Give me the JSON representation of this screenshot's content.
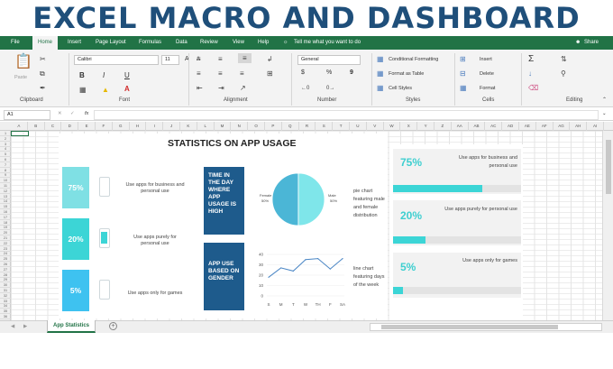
{
  "banner": {
    "title": "EXCEL MACRO AND DASHBOARD"
  },
  "menu": {
    "tabs": [
      "File",
      "Home",
      "Insert",
      "Page Layout",
      "Formulas",
      "Data",
      "Review",
      "View",
      "Help"
    ],
    "tell_me": "Tell me what you want to do",
    "share": "Share"
  },
  "ribbon": {
    "clipboard": {
      "paste": "Paste",
      "label": "Clipboard"
    },
    "font": {
      "name": "Calibri",
      "size": "11",
      "bold": "B",
      "italic": "I",
      "underline": "U",
      "grow": "A",
      "shrink": "A",
      "label": "Font"
    },
    "alignment": {
      "label": "Alignment"
    },
    "number": {
      "format": "General",
      "currency": "$",
      "percent": "%",
      "comma": "9",
      "label": "Number"
    },
    "styles": {
      "conditional": "Conditional Formatting",
      "table": "Format as Table",
      "cell": "Cell Styles",
      "label": "Styles"
    },
    "cells": {
      "insert": "Insert",
      "delete": "Delete",
      "format": "Format",
      "label": "Cells"
    },
    "editing": {
      "sum": "Σ",
      "label": "Editing"
    }
  },
  "formula_bar": {
    "cell_ref": "A1",
    "fx": "fx",
    "value": ""
  },
  "columns": [
    "A",
    "B",
    "C",
    "D",
    "E",
    "F",
    "G",
    "H",
    "I",
    "J",
    "K",
    "L",
    "M",
    "N",
    "O",
    "P",
    "Q",
    "R",
    "S",
    "T",
    "U",
    "V",
    "W",
    "X",
    "Y",
    "Z",
    "AA",
    "AB",
    "AC",
    "AD",
    "AE",
    "AF",
    "AG",
    "AH",
    "AI"
  ],
  "rows": [
    "1",
    "2",
    "3",
    "4",
    "5",
    "6",
    "7",
    "8",
    "9",
    "10",
    "11",
    "12",
    "13",
    "14",
    "15",
    "16",
    "17",
    "18",
    "19",
    "20",
    "21",
    "22",
    "23",
    "24",
    "25",
    "26",
    "27",
    "28",
    "29",
    "30",
    "31",
    "32",
    "33",
    "34",
    "35",
    "36"
  ],
  "dashboard": {
    "title": "STATISTICS ON APP USAGE",
    "stats": [
      {
        "pct": "75%",
        "text": "Use apps for business and personal use"
      },
      {
        "pct": "20%",
        "text": "Use apps purely for personal use"
      },
      {
        "pct": "5%",
        "text": "Use apps only for games"
      }
    ],
    "boxes": [
      {
        "text": "TIME IN THE DAY WHERE APP USAGE IS HIGH"
      },
      {
        "text": "APP USE BASED ON GENDER"
      }
    ],
    "pie_note": "pie chart featuring male and female distribution",
    "line_note": "line chart featuring days of the week",
    "right_cards": [
      {
        "pct": "75%",
        "text": "Use apps for business and personal use",
        "fill": 0.7
      },
      {
        "pct": "20%",
        "text": "Use apps purely for personal use",
        "fill": 0.25
      },
      {
        "pct": "5%",
        "text": "Use apps only for games",
        "fill": 0.08
      }
    ],
    "colors": {
      "teal": "#3cd5d6",
      "navy": "#1e5b8c",
      "excel_green": "#217346"
    }
  },
  "chart_data": [
    {
      "type": "pie",
      "labels": [
        "Female",
        "Male"
      ],
      "values": [
        50,
        50
      ],
      "data_labels": [
        "50%",
        "50%"
      ]
    },
    {
      "type": "line",
      "categories": [
        "S",
        "M",
        "T",
        "W",
        "TH",
        "F",
        "SA"
      ],
      "values": [
        18,
        27,
        24,
        35,
        36,
        26,
        36
      ],
      "ylim": [
        0,
        40
      ],
      "yticks": [
        "0",
        "10",
        "20",
        "30",
        "40"
      ]
    }
  ],
  "sheet": {
    "tab": "App Statistics",
    "add": "+"
  }
}
